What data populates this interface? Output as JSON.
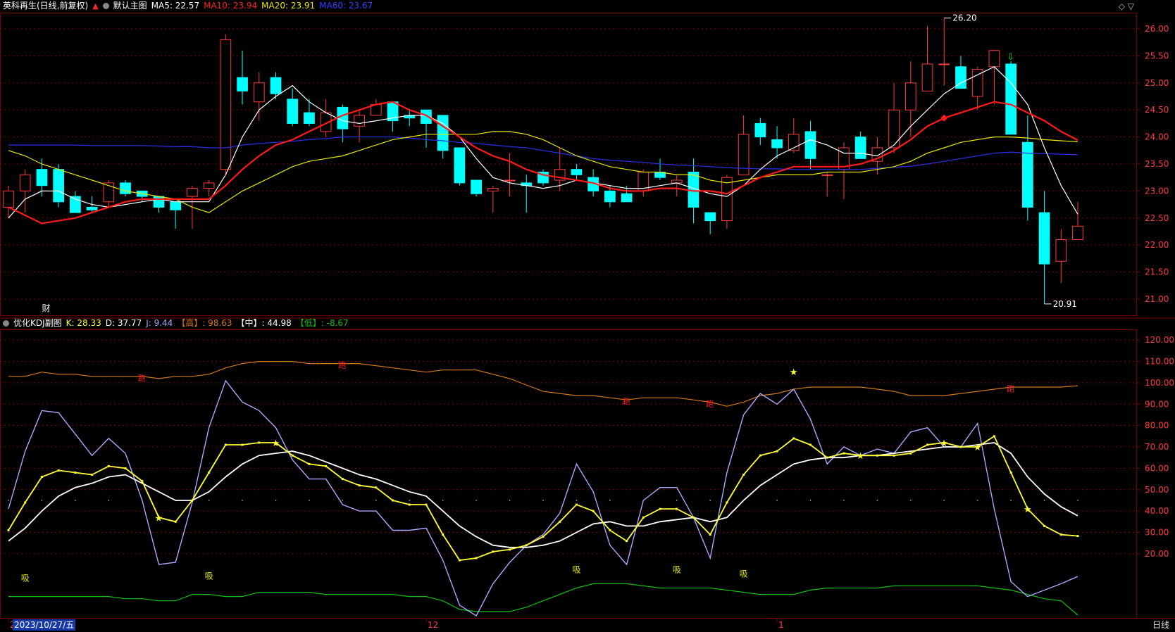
{
  "main_header": {
    "title": "英科再生(日线,前复权)",
    "main_chart_name": "默认主图",
    "ma5": "MA5: 22.57",
    "ma10": "MA10: 23.94",
    "ma20": "MA20: 23.91",
    "ma60": "MA60: 23.67"
  },
  "sub_header": {
    "name": "优化KDJ副图",
    "k": "K: 28.33",
    "d": "D: 37.77",
    "j": "J: 9.44",
    "high": "【高】: 98.63",
    "mid": "【中】: 44.98",
    "low": "【低】: -8.67"
  },
  "colors": {
    "bg": "#000000",
    "grid": "#7a0000",
    "rise": "#ff3b3b",
    "fall": "#00ffff",
    "ma5": "#ffffff",
    "ma10": "#ff1a1a",
    "ma20": "#e8e800",
    "ma60": "#2830e8",
    "k": "#ffff33",
    "d": "#ffffff",
    "j": "#a8a8ff",
    "high": "#d2781c",
    "low": "#10c010"
  },
  "icons": {
    "top_right": "diamond-icon",
    "settings": "circle-settings-icon",
    "up": "arrow-up-icon"
  },
  "top_right_icons": "◇ ▽",
  "period_label": "日线",
  "date_label": "2023/10/27/五",
  "x_tick_labels": [
    "2",
    "12",
    "1"
  ],
  "finance_marker": "财",
  "annotations": {
    "max_price": "26.20",
    "min_price": "20.91"
  },
  "chart_data": [
    {
      "type": "candlestick",
      "title": "英科再生(日线,前复权)",
      "ylim": [
        20.7,
        26.3
      ],
      "y_ticks": [
        21.0,
        21.5,
        22.0,
        22.5,
        23.0,
        23.5,
        24.0,
        24.5,
        25.0,
        25.5,
        26.0
      ],
      "y_tick_labels": [
        "21.00",
        "21.50",
        "22.00",
        "22.50",
        "23.00",
        "23.50",
        "24.00",
        "24.50",
        "25.00",
        "25.50",
        "26.00"
      ],
      "candles": [
        {
          "o": 22.7,
          "h": 23.1,
          "l": 22.5,
          "c": 23.0
        },
        {
          "o": 23.0,
          "h": 23.4,
          "l": 22.6,
          "c": 23.3
        },
        {
          "o": 23.4,
          "h": 23.6,
          "l": 22.9,
          "c": 23.1
        },
        {
          "o": 23.4,
          "h": 23.5,
          "l": 22.7,
          "c": 22.8
        },
        {
          "o": 22.9,
          "h": 23.0,
          "l": 22.6,
          "c": 22.6
        },
        {
          "o": 22.7,
          "h": 22.9,
          "l": 22.6,
          "c": 22.65
        },
        {
          "o": 22.8,
          "h": 23.2,
          "l": 22.7,
          "c": 23.15
        },
        {
          "o": 23.15,
          "h": 23.2,
          "l": 22.9,
          "c": 22.95
        },
        {
          "o": 23.0,
          "h": 23.0,
          "l": 22.8,
          "c": 22.9
        },
        {
          "o": 22.9,
          "h": 22.9,
          "l": 22.6,
          "c": 22.7
        },
        {
          "o": 22.8,
          "h": 22.8,
          "l": 22.3,
          "c": 22.65
        },
        {
          "o": 22.9,
          "h": 23.1,
          "l": 22.3,
          "c": 23.05
        },
        {
          "o": 23.05,
          "h": 23.2,
          "l": 22.9,
          "c": 23.15
        },
        {
          "o": 23.4,
          "h": 25.9,
          "l": 23.3,
          "c": 25.8
        },
        {
          "o": 25.1,
          "h": 25.6,
          "l": 24.6,
          "c": 24.85
        },
        {
          "o": 24.65,
          "h": 25.2,
          "l": 24.3,
          "c": 25.0
        },
        {
          "o": 25.1,
          "h": 25.2,
          "l": 24.7,
          "c": 24.8
        },
        {
          "o": 24.7,
          "h": 24.9,
          "l": 24.2,
          "c": 24.25
        },
        {
          "o": 24.45,
          "h": 24.7,
          "l": 24.2,
          "c": 24.25
        },
        {
          "o": 24.1,
          "h": 24.7,
          "l": 24.0,
          "c": 24.45
        },
        {
          "o": 24.55,
          "h": 24.6,
          "l": 23.9,
          "c": 24.15
        },
        {
          "o": 24.2,
          "h": 24.5,
          "l": 23.9,
          "c": 24.4
        },
        {
          "o": 24.4,
          "h": 24.7,
          "l": 24.4,
          "c": 24.6
        },
        {
          "o": 24.65,
          "h": 24.65,
          "l": 24.1,
          "c": 24.3
        },
        {
          "o": 24.4,
          "h": 24.5,
          "l": 24.2,
          "c": 24.35
        },
        {
          "o": 24.5,
          "h": 24.5,
          "l": 23.8,
          "c": 24.25
        },
        {
          "o": 24.4,
          "h": 24.4,
          "l": 23.6,
          "c": 23.75
        },
        {
          "o": 23.8,
          "h": 23.8,
          "l": 23.1,
          "c": 23.15
        },
        {
          "o": 23.2,
          "h": 23.2,
          "l": 22.9,
          "c": 22.95
        },
        {
          "o": 23.0,
          "h": 23.1,
          "l": 22.6,
          "c": 23.05
        },
        {
          "o": 23.2,
          "h": 23.7,
          "l": 22.9,
          "c": 23.2
        },
        {
          "o": 23.15,
          "h": 23.3,
          "l": 22.6,
          "c": 23.1
        },
        {
          "o": 23.35,
          "h": 23.4,
          "l": 23.1,
          "c": 23.15
        },
        {
          "o": 23.2,
          "h": 23.8,
          "l": 23.0,
          "c": 23.4
        },
        {
          "o": 23.4,
          "h": 23.5,
          "l": 23.2,
          "c": 23.3
        },
        {
          "o": 23.25,
          "h": 23.4,
          "l": 22.9,
          "c": 23.0
        },
        {
          "o": 23.0,
          "h": 23.1,
          "l": 22.7,
          "c": 22.8
        },
        {
          "o": 22.95,
          "h": 23.1,
          "l": 22.8,
          "c": 22.8
        },
        {
          "o": 23.0,
          "h": 23.4,
          "l": 22.9,
          "c": 23.35
        },
        {
          "o": 23.35,
          "h": 23.6,
          "l": 23.2,
          "c": 23.25
        },
        {
          "o": 23.15,
          "h": 23.3,
          "l": 22.9,
          "c": 23.2
        },
        {
          "o": 23.35,
          "h": 23.6,
          "l": 22.4,
          "c": 22.7
        },
        {
          "o": 22.6,
          "h": 22.6,
          "l": 22.2,
          "c": 22.45
        },
        {
          "o": 22.45,
          "h": 23.3,
          "l": 22.3,
          "c": 23.25
        },
        {
          "o": 23.3,
          "h": 24.4,
          "l": 23.3,
          "c": 24.05
        },
        {
          "o": 24.25,
          "h": 24.35,
          "l": 23.85,
          "c": 24.0
        },
        {
          "o": 23.95,
          "h": 24.2,
          "l": 23.6,
          "c": 23.8
        },
        {
          "o": 23.75,
          "h": 24.35,
          "l": 23.7,
          "c": 24.05
        },
        {
          "o": 24.1,
          "h": 24.3,
          "l": 23.4,
          "c": 23.6
        },
        {
          "o": 23.3,
          "h": 23.35,
          "l": 22.9,
          "c": 23.3
        },
        {
          "o": 23.4,
          "h": 23.9,
          "l": 22.85,
          "c": 23.8
        },
        {
          "o": 24.0,
          "h": 24.1,
          "l": 23.6,
          "c": 23.6
        },
        {
          "o": 23.55,
          "h": 24.0,
          "l": 23.3,
          "c": 23.8
        },
        {
          "o": 23.8,
          "h": 25.0,
          "l": 23.7,
          "c": 24.5
        },
        {
          "o": 24.5,
          "h": 25.4,
          "l": 24.0,
          "c": 25.0
        },
        {
          "o": 24.85,
          "h": 26.05,
          "l": 24.85,
          "c": 25.35
        },
        {
          "o": 25.35,
          "h": 26.2,
          "l": 24.95,
          "c": 25.35
        },
        {
          "o": 25.3,
          "h": 25.5,
          "l": 24.9,
          "c": 24.9
        },
        {
          "o": 24.75,
          "h": 25.3,
          "l": 24.5,
          "c": 25.25
        },
        {
          "o": 25.3,
          "h": 25.6,
          "l": 24.6,
          "c": 25.6
        },
        {
          "o": 25.35,
          "h": 25.4,
          "l": 24.05,
          "c": 24.05
        },
        {
          "o": 23.9,
          "h": 24.4,
          "l": 22.45,
          "c": 22.7
        },
        {
          "o": 22.6,
          "h": 23.0,
          "l": 20.91,
          "c": 21.65
        },
        {
          "o": 21.7,
          "h": 22.3,
          "l": 21.3,
          "c": 22.1
        },
        {
          "o": 22.1,
          "h": 22.8,
          "l": 22.1,
          "c": 22.35
        }
      ],
      "ma5": [
        22.5,
        22.85,
        23.0,
        23.0,
        22.85,
        22.75,
        22.7,
        22.75,
        22.8,
        22.85,
        22.8,
        22.8,
        22.8,
        23.3,
        24.0,
        24.5,
        24.75,
        24.95,
        24.65,
        24.45,
        24.3,
        24.25,
        24.3,
        24.35,
        24.4,
        24.4,
        24.25,
        24.0,
        23.6,
        23.25,
        23.15,
        23.1,
        23.05,
        23.1,
        23.2,
        23.15,
        23.1,
        23.05,
        23.05,
        23.1,
        23.15,
        23.05,
        22.95,
        22.9,
        23.1,
        23.4,
        23.65,
        23.8,
        23.95,
        23.85,
        23.7,
        23.7,
        23.65,
        23.85,
        24.2,
        24.5,
        24.8,
        25.0,
        25.15,
        25.3,
        25.0,
        24.6,
        23.8,
        23.1,
        22.57
      ],
      "ma10": [
        22.7,
        22.55,
        22.4,
        22.45,
        22.5,
        22.6,
        22.7,
        22.8,
        22.85,
        22.85,
        22.85,
        22.85,
        22.85,
        23.1,
        23.4,
        23.65,
        23.85,
        23.95,
        24.1,
        24.25,
        24.4,
        24.5,
        24.6,
        24.65,
        24.5,
        24.4,
        24.2,
        24.0,
        23.8,
        23.65,
        23.55,
        23.4,
        23.3,
        23.25,
        23.2,
        23.15,
        23.05,
        23.0,
        23.0,
        23.05,
        23.05,
        23.0,
        23.0,
        22.95,
        23.1,
        23.25,
        23.35,
        23.45,
        23.45,
        23.45,
        23.45,
        23.5,
        23.6,
        23.75,
        23.95,
        24.2,
        24.35,
        24.45,
        24.55,
        24.65,
        24.6,
        24.45,
        24.3,
        24.1,
        23.94
      ],
      "ma20": [
        23.75,
        23.65,
        23.5,
        23.4,
        23.3,
        23.2,
        23.1,
        23.0,
        22.95,
        22.9,
        22.85,
        22.7,
        22.6,
        22.8,
        23.0,
        23.15,
        23.3,
        23.45,
        23.55,
        23.6,
        23.65,
        23.75,
        23.85,
        23.95,
        24.0,
        24.05,
        24.05,
        24.05,
        24.05,
        24.1,
        24.1,
        24.05,
        23.95,
        23.8,
        23.65,
        23.55,
        23.45,
        23.4,
        23.35,
        23.35,
        23.3,
        23.3,
        23.2,
        23.15,
        23.2,
        23.25,
        23.3,
        23.3,
        23.3,
        23.35,
        23.35,
        23.35,
        23.4,
        23.45,
        23.55,
        23.7,
        23.8,
        23.9,
        23.95,
        24.0,
        24.0,
        23.98,
        23.95,
        23.93,
        23.91
      ],
      "ma60": [
        23.85,
        23.85,
        23.85,
        23.85,
        23.85,
        23.84,
        23.84,
        23.84,
        23.84,
        23.83,
        23.82,
        23.82,
        23.8,
        23.8,
        23.85,
        23.88,
        23.9,
        23.92,
        23.95,
        23.97,
        24.0,
        24.0,
        24.0,
        24.0,
        23.98,
        23.95,
        23.93,
        23.9,
        23.88,
        23.85,
        23.82,
        23.8,
        23.75,
        23.7,
        23.65,
        23.6,
        23.57,
        23.55,
        23.53,
        23.5,
        23.48,
        23.47,
        23.45,
        23.43,
        23.42,
        23.41,
        23.41,
        23.4,
        23.4,
        23.4,
        23.4,
        23.4,
        23.42,
        23.44,
        23.46,
        23.5,
        23.55,
        23.6,
        23.65,
        23.7,
        23.72,
        23.7,
        23.69,
        23.68,
        23.67
      ]
    },
    {
      "type": "line",
      "title": "优化KDJ副图",
      "ylim": [
        -10,
        125
      ],
      "y_ticks": [
        20,
        30,
        40,
        50,
        60,
        70,
        80,
        90,
        100,
        110,
        120
      ],
      "y_tick_labels": [
        "20.00",
        "30.00",
        "40.00",
        "50.00",
        "60.00",
        "70.00",
        "80.00",
        "90.00",
        "100.00",
        "110.00",
        "120.00"
      ],
      "series": [
        {
          "name": "K",
          "values": [
            31,
            44,
            56,
            59,
            58,
            57,
            61,
            60,
            54,
            37,
            35,
            45,
            58,
            71,
            71,
            72,
            72,
            66,
            62,
            61,
            55,
            52,
            51,
            45,
            43,
            43,
            29,
            17,
            18,
            21,
            22,
            24,
            28,
            35,
            43,
            40,
            31,
            26,
            37,
            41,
            41,
            37,
            29,
            44,
            57,
            66,
            68,
            74,
            71,
            65,
            67,
            66,
            66,
            66,
            67,
            71,
            72,
            70,
            70,
            75,
            58,
            41,
            33,
            29,
            28.33
          ]
        },
        {
          "name": "D",
          "values": [
            26,
            32,
            40,
            47,
            51,
            53,
            56,
            57,
            53,
            49,
            45,
            45,
            49,
            56,
            62,
            66,
            67,
            68,
            66,
            63,
            60,
            57,
            55,
            52,
            49,
            47,
            40,
            33,
            28,
            24,
            23,
            23,
            24,
            26,
            30,
            34,
            35,
            33,
            33,
            35,
            36,
            37,
            35,
            37,
            45,
            52,
            57,
            62,
            64,
            65,
            65,
            66,
            66,
            67,
            68,
            69,
            70,
            70,
            71,
            72,
            67,
            56,
            48,
            42,
            37.77
          ]
        },
        {
          "name": "J",
          "values": [
            41,
            68,
            87,
            86,
            76,
            66,
            74,
            67,
            45,
            15,
            16,
            44,
            79,
            101,
            91,
            87,
            79,
            64,
            55,
            55,
            43,
            40,
            40,
            31,
            31,
            32,
            17,
            -4,
            -9,
            6,
            16,
            24,
            29,
            39,
            62,
            49,
            24,
            15,
            45,
            51,
            51,
            37,
            18,
            58,
            85,
            95,
            90,
            97,
            83,
            62,
            70,
            66,
            69,
            67,
            77,
            79,
            70,
            70,
            81,
            41,
            7,
            0,
            3,
            6,
            9.44
          ]
        },
        {
          "name": "高",
          "values": [
            103,
            103,
            105,
            104,
            104,
            103,
            103,
            103,
            103,
            102,
            103,
            103,
            104,
            107,
            109,
            110,
            110,
            110,
            109,
            109,
            109,
            109,
            108,
            107,
            106,
            105,
            106,
            106,
            106,
            104,
            102,
            99,
            96,
            95,
            94,
            94,
            93,
            92,
            93,
            93,
            93,
            92,
            91,
            89,
            91,
            94,
            95,
            97,
            98,
            98,
            98,
            98,
            97,
            96,
            94,
            94,
            94,
            95,
            96,
            97,
            98,
            98,
            98,
            98,
            98.63
          ]
        },
        {
          "name": "中",
          "values": [
            45,
            45,
            45,
            45,
            45,
            45,
            45,
            45,
            45,
            45,
            45,
            45,
            45,
            45,
            45,
            45,
            45,
            45,
            45,
            45,
            45,
            45,
            45,
            45,
            45,
            45,
            45,
            45,
            45,
            45,
            45,
            45,
            45,
            45,
            45,
            45,
            45,
            45,
            45,
            45,
            45,
            45,
            45,
            45,
            45,
            45,
            45,
            45,
            45,
            45,
            45,
            45,
            45,
            45,
            45,
            45,
            45,
            45,
            45,
            45,
            45,
            45,
            45,
            45,
            44.98
          ]
        },
        {
          "name": "低",
          "values": [
            0,
            0,
            0,
            0,
            0,
            0,
            0,
            -1,
            -1,
            -2,
            -2,
            1,
            1,
            0,
            0,
            2,
            2,
            2,
            2,
            1,
            1,
            1,
            1,
            1,
            0,
            0,
            -2,
            -6,
            -7,
            -7,
            -7,
            -5,
            -2,
            1,
            4,
            6,
            6,
            6,
            5,
            4,
            4,
            4,
            4,
            3,
            2,
            1,
            1,
            1,
            3,
            4,
            4,
            4,
            4,
            5,
            5,
            5,
            5,
            5,
            5,
            4,
            3,
            1,
            -1,
            -2,
            -8.67
          ]
        }
      ],
      "signals": {
        "star_k": [
          9,
          16,
          51,
          56,
          58,
          61
        ],
        "star_high": [
          47
        ],
        "xi_text": "吸",
        "xi_index": [
          1,
          12,
          34,
          40,
          44
        ],
        "pao_text": "跑",
        "pao_index": [
          8,
          20,
          37,
          42,
          60
        ]
      }
    }
  ]
}
